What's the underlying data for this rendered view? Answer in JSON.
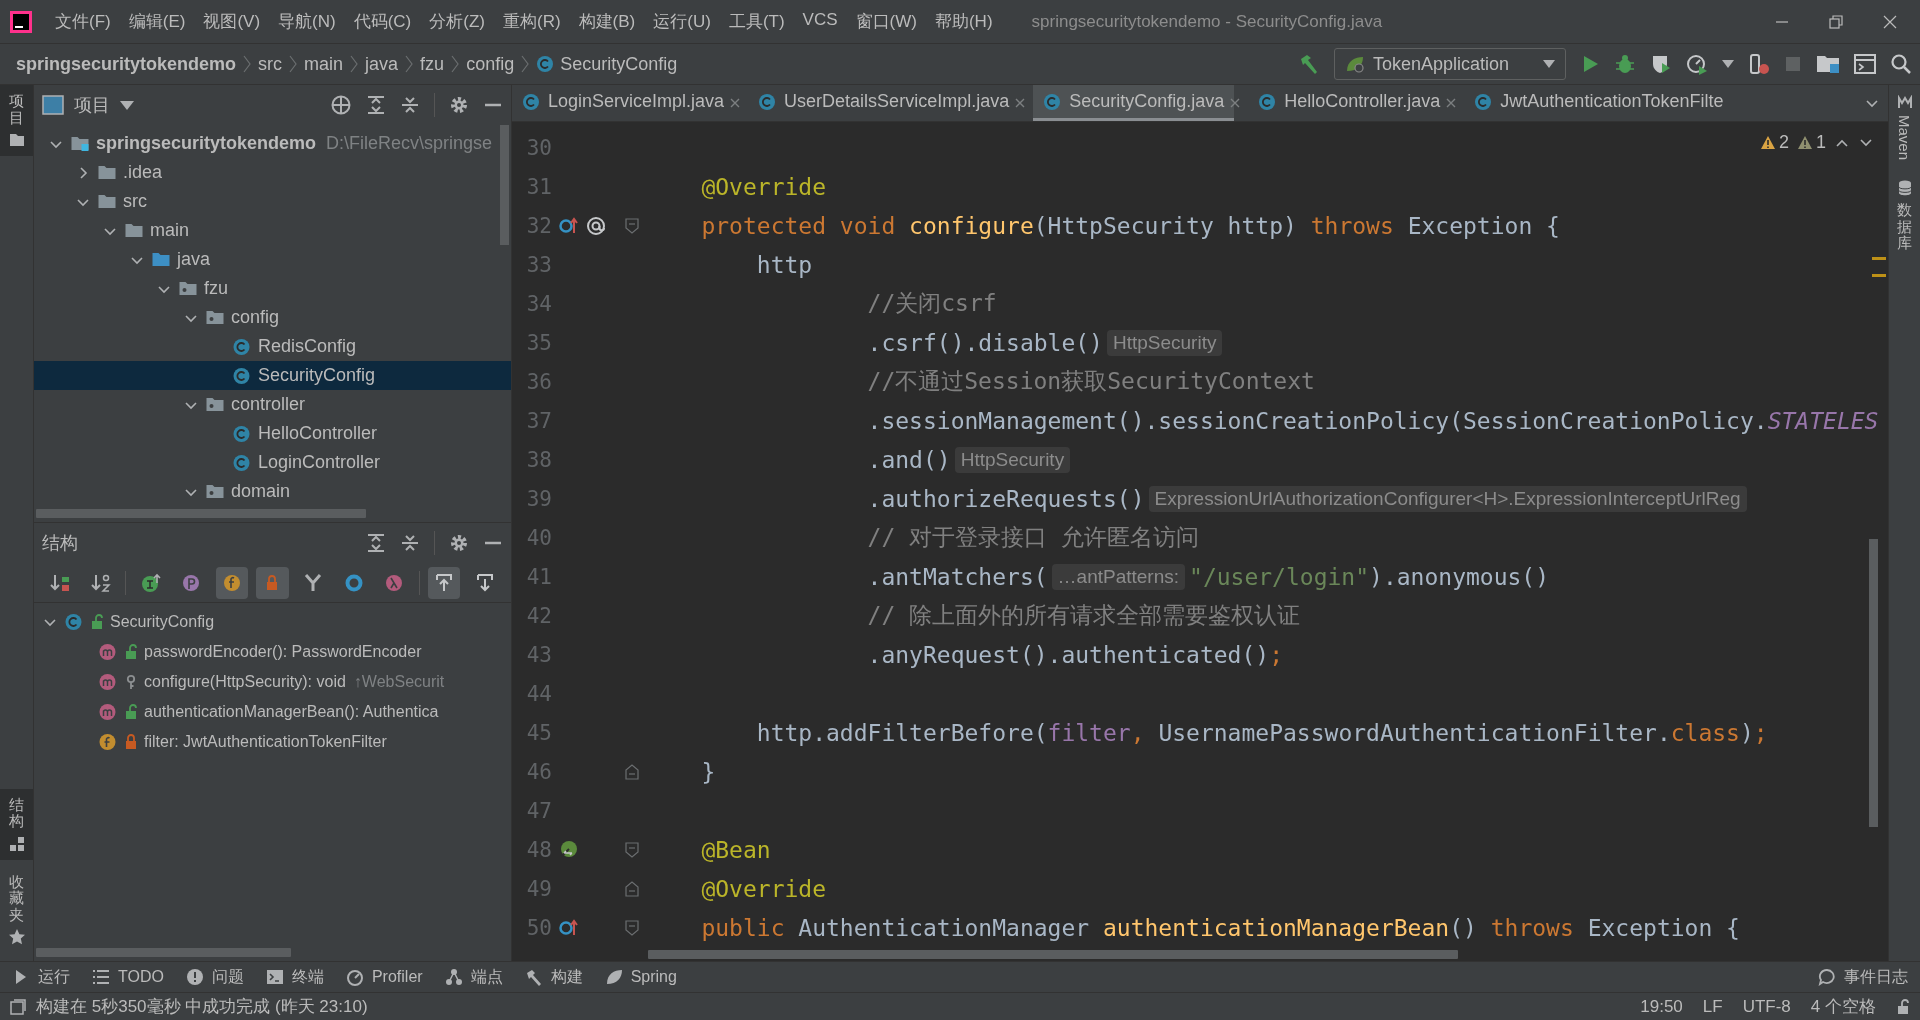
{
  "window": {
    "title": "springsecuritytokendemo - SecurityConfig.java",
    "menu": [
      "文件(F)",
      "编辑(E)",
      "视图(V)",
      "导航(N)",
      "代码(C)",
      "分析(Z)",
      "重构(R)",
      "构建(B)",
      "运行(U)",
      "工具(T)",
      "VCS",
      "窗口(W)",
      "帮助(H)"
    ]
  },
  "breadcrumbs": [
    {
      "label": "springsecuritytokendemo",
      "kind": "project"
    },
    {
      "label": "src",
      "kind": "folder"
    },
    {
      "label": "main",
      "kind": "folder"
    },
    {
      "label": "java",
      "kind": "folder"
    },
    {
      "label": "fzu",
      "kind": "folder"
    },
    {
      "label": "config",
      "kind": "folder"
    },
    {
      "label": "SecurityConfig",
      "kind": "class"
    }
  ],
  "run_config": {
    "label": "TokenApplication"
  },
  "left_stripe": {
    "top": [
      {
        "label": "项目",
        "selected": true
      }
    ],
    "bottom": [
      {
        "label": "结构",
        "selected": true
      },
      {
        "label": "收藏夹",
        "selected": false
      }
    ]
  },
  "right_stripe": [
    {
      "label": "Maven",
      "kind": "latin"
    },
    {
      "label": "数据库",
      "kind": "cjk"
    }
  ],
  "project_panel": {
    "title": "项目",
    "tree": [
      {
        "name": "springsecuritytokendemo",
        "path": "D:\\FileRecv\\springse",
        "kind": "module",
        "expanded": true,
        "selected": false,
        "children": [
          {
            "name": ".idea",
            "kind": "folder",
            "expanded": false,
            "selected": false
          },
          {
            "name": "src",
            "kind": "folder",
            "expanded": true,
            "selected": false,
            "children": [
              {
                "name": "main",
                "kind": "folder",
                "expanded": true,
                "selected": false,
                "children": [
                  {
                    "name": "java",
                    "kind": "source",
                    "expanded": true,
                    "selected": false,
                    "children": [
                      {
                        "name": "fzu",
                        "kind": "package",
                        "expanded": true,
                        "selected": false,
                        "children": [
                          {
                            "name": "config",
                            "kind": "package",
                            "expanded": true,
                            "selected": false,
                            "children": [
                              {
                                "name": "RedisConfig",
                                "kind": "class",
                                "selected": false
                              },
                              {
                                "name": "SecurityConfig",
                                "kind": "class",
                                "selected": true
                              }
                            ]
                          },
                          {
                            "name": "controller",
                            "kind": "package",
                            "expanded": true,
                            "selected": false,
                            "children": [
                              {
                                "name": "HelloController",
                                "kind": "class",
                                "selected": false
                              },
                              {
                                "name": "LoginController",
                                "kind": "class",
                                "selected": false
                              }
                            ]
                          },
                          {
                            "name": "domain",
                            "kind": "package",
                            "expanded": true,
                            "selected": false
                          }
                        ]
                      }
                    ]
                  }
                ]
              }
            ]
          }
        ]
      }
    ]
  },
  "structure_panel": {
    "title": "结构",
    "toolbar": [
      [
        {
          "kind": "sort-visibility",
          "on": false
        },
        {
          "kind": "sort-alpha",
          "on": false
        }
      ],
      [
        {
          "kind": "inherited",
          "on": false
        },
        {
          "kind": "properties",
          "on": false
        },
        {
          "kind": "fields",
          "on": true
        },
        {
          "kind": "non-public",
          "on": true
        },
        {
          "kind": "fork",
          "on": false
        },
        {
          "kind": "anonymous",
          "on": false
        },
        {
          "kind": "lambda",
          "on": false
        }
      ],
      [
        {
          "kind": "scroll-to-source",
          "on": true
        },
        {
          "kind": "scroll-from-source",
          "on": false
        }
      ]
    ],
    "tree": [
      {
        "name": "SecurityConfig",
        "kind": "public-class",
        "expanded": true,
        "selected": false,
        "children": [
          {
            "name": "passwordEncoder(): PasswordEncoder",
            "kind": "public-method",
            "selected": false
          },
          {
            "name": "configure(HttpSecurity): void",
            "hint": "↑WebSecurit",
            "kind": "protected-method",
            "selected": false
          },
          {
            "name": "authenticationManagerBean(): Authentica",
            "kind": "public-method",
            "selected": false
          },
          {
            "name": "filter: JwtAuthenticationTokenFilter",
            "kind": "private-field",
            "selected": false
          }
        ]
      }
    ]
  },
  "editor": {
    "tabs": [
      {
        "label": "LoginServiceImpl.java",
        "selected": false,
        "closable": true
      },
      {
        "label": "UserDetailsServiceImpl.java",
        "selected": false,
        "closable": true
      },
      {
        "label": "SecurityConfig.java",
        "selected": true,
        "closable": true
      },
      {
        "label": "HelloController.java",
        "selected": false,
        "closable": true
      },
      {
        "label": "JwtAuthenticationTokenFilte",
        "selected": false,
        "closable": false
      }
    ],
    "inspections": [
      {
        "kind": "warning",
        "count": "2"
      },
      {
        "kind": "weak-warning",
        "count": "1"
      }
    ],
    "lines": [
      {
        "no": "30"
      },
      {
        "no": "31",
        "tokens": [
          {
            "t": "    @Override",
            "kind": "annotation"
          }
        ]
      },
      {
        "no": "32",
        "gutter": [
          {
            "kind": "implements-up"
          },
          {
            "kind": "at"
          }
        ],
        "fold": {
          "kind": "start"
        },
        "tokens": [
          {
            "t": "    protected void ",
            "kind": "keyword"
          },
          {
            "t": "configure",
            "kind": "method"
          },
          {
            "t": "(HttpSecurity http) ",
            "kind": "plain"
          },
          {
            "t": "throws",
            "kind": "keyword"
          },
          {
            "t": " Exception {",
            "kind": "plain"
          }
        ]
      },
      {
        "no": "33",
        "tokens": [
          {
            "t": "        http",
            "kind": "plain"
          }
        ]
      },
      {
        "no": "34",
        "tokens": [
          {
            "t": "                //关闭csrf",
            "kind": "comment"
          }
        ]
      },
      {
        "no": "35",
        "tokens": [
          {
            "t": "                .csrf().disable()",
            "kind": "plain"
          },
          {
            "t": "HttpSecurity",
            "kind": "hint"
          }
        ]
      },
      {
        "no": "36",
        "tokens": [
          {
            "t": "                //不通过Session获取SecurityContext",
            "kind": "comment"
          }
        ]
      },
      {
        "no": "37",
        "tokens": [
          {
            "t": "                .sessionManagement().sessionCreationPolicy(SessionCreationPolicy.",
            "kind": "plain"
          },
          {
            "t": "STATELES",
            "kind": "constant"
          }
        ]
      },
      {
        "no": "38",
        "tokens": [
          {
            "t": "                .and()",
            "kind": "plain"
          },
          {
            "t": "HttpSecurity",
            "kind": "hint"
          }
        ]
      },
      {
        "no": "39",
        "tokens": [
          {
            "t": "                .authorizeRequests()",
            "kind": "plain"
          },
          {
            "t": "ExpressionUrlAuthorizationConfigurer<H>.ExpressionInterceptUrlReg",
            "kind": "hint"
          }
        ]
      },
      {
        "no": "40",
        "tokens": [
          {
            "t": "                // 对于登录接口 允许匿名访问",
            "kind": "comment"
          }
        ]
      },
      {
        "no": "41",
        "tokens": [
          {
            "t": "                .antMatchers(",
            "kind": "plain"
          },
          {
            "t": "…antPatterns:",
            "kind": "hint"
          },
          {
            "t": "\"/user/login\"",
            "kind": "string"
          },
          {
            "t": ").anonymous()",
            "kind": "plain"
          }
        ]
      },
      {
        "no": "42",
        "tokens": [
          {
            "t": "                // 除上面外的所有请求全部需要鉴权认证",
            "kind": "comment"
          }
        ]
      },
      {
        "no": "43",
        "tokens": [
          {
            "t": "                .anyRequest().authenticated()",
            "kind": "plain"
          },
          {
            "t": ";",
            "kind": "keyword"
          }
        ]
      },
      {
        "no": "44"
      },
      {
        "no": "45",
        "tokens": [
          {
            "t": "        http.addFilterBefore(",
            "kind": "plain"
          },
          {
            "t": "filter",
            "kind": "field"
          },
          {
            "t": ",",
            "kind": "keyword"
          },
          {
            "t": " UsernamePasswordAuthenticationFilter.",
            "kind": "plain"
          },
          {
            "t": "class",
            "kind": "keyword"
          },
          {
            "t": ")",
            "kind": "plain"
          },
          {
            "t": ";",
            "kind": "keyword"
          }
        ]
      },
      {
        "no": "46",
        "fold": {
          "kind": "end"
        },
        "tokens": [
          {
            "t": "    }",
            "kind": "plain"
          }
        ]
      },
      {
        "no": "47"
      },
      {
        "no": "48",
        "gutter": [
          {
            "kind": "bean"
          }
        ],
        "fold": {
          "kind": "start"
        },
        "tokens": [
          {
            "t": "    @Bean",
            "kind": "annotation"
          }
        ]
      },
      {
        "no": "49",
        "fold": {
          "kind": "end"
        },
        "tokens": [
          {
            "t": "    @Override",
            "kind": "annotation"
          }
        ]
      },
      {
        "no": "50",
        "gutter": [
          {
            "kind": "implements-up"
          }
        ],
        "fold": {
          "kind": "start"
        },
        "tokens": [
          {
            "t": "    public ",
            "kind": "keyword"
          },
          {
            "t": "AuthenticationManager ",
            "kind": "plain"
          },
          {
            "t": "authenticationManagerBean",
            "kind": "method"
          },
          {
            "t": "() ",
            "kind": "plain"
          },
          {
            "t": "throws",
            "kind": "keyword"
          },
          {
            "t": " Exception {",
            "kind": "plain"
          }
        ]
      }
    ]
  },
  "tool_windows": {
    "left": [
      {
        "label": "运行",
        "kind": "run"
      },
      {
        "label": "TODO",
        "kind": "todo"
      },
      {
        "label": "问题",
        "kind": "problems"
      },
      {
        "label": "终端",
        "kind": "terminal"
      },
      {
        "label": "Profiler",
        "kind": "profiler"
      },
      {
        "label": "端点",
        "kind": "endpoints"
      },
      {
        "label": "构建",
        "kind": "build"
      },
      {
        "label": "Spring",
        "kind": "spring"
      }
    ],
    "right": [
      {
        "label": "事件日志",
        "kind": "event-log"
      }
    ]
  },
  "status_bar": {
    "message": "构建在 5秒350毫秒 中成功完成 (昨天 23:10)",
    "items": [
      "19:50",
      "LF",
      "UTF-8",
      "4 个空格"
    ]
  }
}
